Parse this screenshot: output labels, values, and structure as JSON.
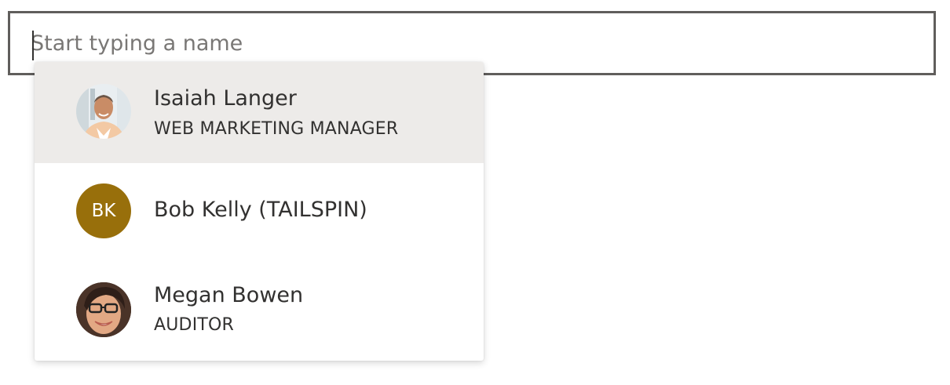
{
  "search": {
    "placeholder": "Start typing a name",
    "value": ""
  },
  "suggestions": [
    {
      "name": "Isaiah Langer",
      "title": "WEB MARKETING MANAGER",
      "avatar": "photo-man-icon",
      "highlighted": true
    },
    {
      "name": "Bob Kelly (TAILSPIN)",
      "title": "",
      "initials": "BK",
      "initials_color": "#986f0b",
      "highlighted": false
    },
    {
      "name": "Megan Bowen",
      "title": "AUDITOR",
      "avatar": "photo-woman-icon",
      "highlighted": false
    }
  ],
  "colors": {
    "border": "#605e5c",
    "hover": "#edebe9",
    "text": "#323130",
    "placeholder": "#797775"
  }
}
